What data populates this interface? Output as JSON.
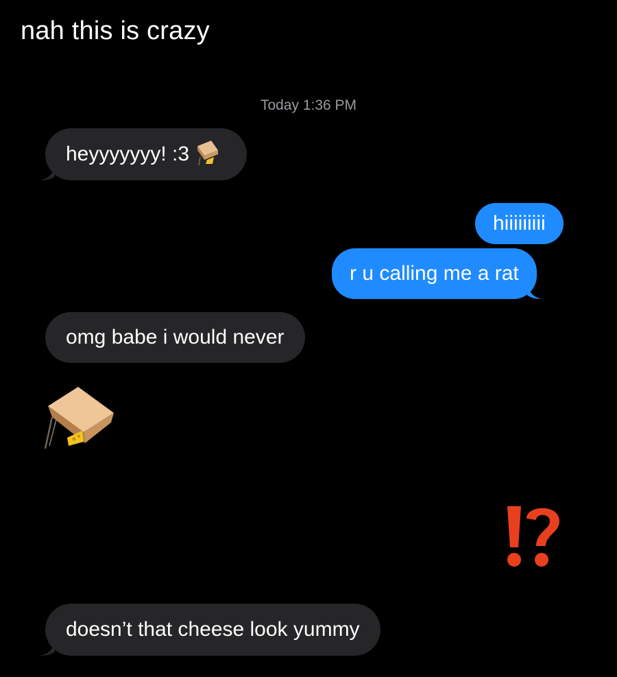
{
  "caption": "nah this is crazy",
  "conversation": {
    "timestamp": "Today 1:36 PM",
    "messages": [
      {
        "direction": "incoming",
        "text": "heyyyyyyy! :3",
        "trailing_emoji": "box-trap-icon"
      },
      {
        "direction": "outgoing",
        "text": "hiiiiiiiii"
      },
      {
        "direction": "outgoing",
        "text": "r u calling me a rat"
      },
      {
        "direction": "incoming",
        "text": "omg babe i would never"
      },
      {
        "direction": "incoming",
        "emoji_only": "box-trap-with-cheese-icon"
      },
      {
        "direction": "outgoing",
        "emoji_only": "interrobang-icon"
      },
      {
        "direction": "incoming",
        "text": "doesn’t that cheese look yummy"
      }
    ]
  },
  "colors": {
    "background": "#000000",
    "incoming_bubble": "#262628",
    "outgoing_bubble": "#1f8bff",
    "timestamp_text": "#9a9aa0",
    "interrobang": "#e8401f"
  }
}
